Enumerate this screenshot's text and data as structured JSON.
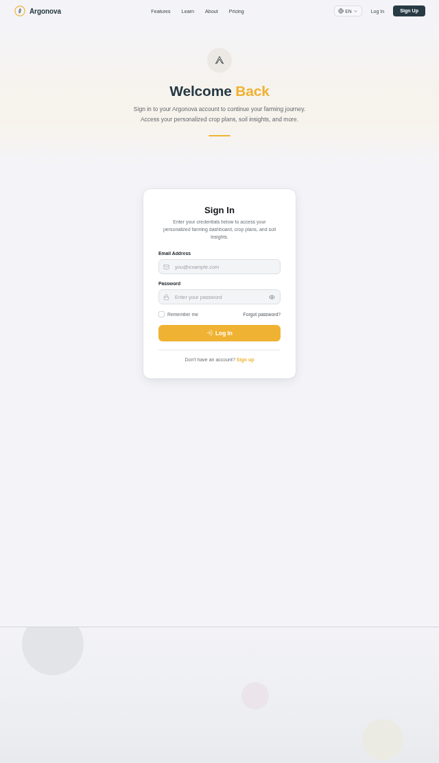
{
  "nav": {
    "brand": "Argonova",
    "links": [
      {
        "label": "Features"
      },
      {
        "label": "Learn"
      },
      {
        "label": "About"
      },
      {
        "label": "Pricing"
      }
    ],
    "language": "EN",
    "login": "Log In",
    "signup": "Sign Up"
  },
  "hero": {
    "title": "Welcome",
    "title_accent": "Back",
    "subtitle": "Sign in to your Argonova account to continue your farming journey. Access your personalized crop plans, soil insights, and more."
  },
  "card": {
    "title": "Sign In",
    "description": "Enter your credentials below to access your personalized farming dashboard, crop plans, and soil insights.",
    "fields": [
      {
        "kind": "email",
        "label": "Email Address",
        "placeholder": "you@example.com"
      },
      {
        "kind": "password",
        "label": "Password",
        "placeholder": "Enter your password"
      }
    ],
    "remember": {
      "label": "Remember me",
      "checked": false
    },
    "forgot": "Forgot password?",
    "submit": "Log In",
    "footer": {
      "text": "Don't have an account?",
      "link": "Sign up"
    }
  }
}
